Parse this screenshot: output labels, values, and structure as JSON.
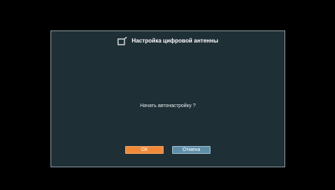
{
  "dialog": {
    "icon": "antenna-settings-icon",
    "title": "Настройка цифровой антенны",
    "message": "Начать автонастройку ?",
    "buttons": {
      "ok_label": "ОК",
      "cancel_label": "Отмена"
    }
  },
  "colors": {
    "screen_background": "#000000",
    "dialog_background": "#1f2f36",
    "dialog_border": "#8e9ca3",
    "ok_button": "#f08a3a",
    "cancel_button": "#5f8ea9"
  }
}
